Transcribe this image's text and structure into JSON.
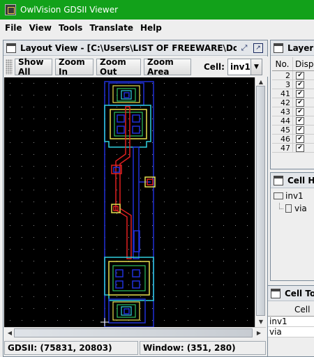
{
  "window": {
    "title": "OwlVision GDSII Viewer"
  },
  "menu": [
    "File",
    "View",
    "Tools",
    "Translate",
    "Help"
  ],
  "layout_view": {
    "title": "Layout View - [C:\\Users\\LIST OF FREEWARE\\Downloa...",
    "buttons": {
      "show_all": "Show All",
      "zoom_in": "Zoom In",
      "zoom_out": "Zoom Out",
      "zoom_area": "Zoom Area"
    },
    "cell_label": "Cell:",
    "cell_value": "inv1"
  },
  "status": {
    "gdsii": "GDSII: (75831, 20803)",
    "window": "Window: (351, 280)"
  },
  "layer_panel": {
    "title": "Layer",
    "columns": [
      "No.",
      "Disp"
    ],
    "rows": [
      "2",
      "3",
      "41",
      "42",
      "43",
      "44",
      "45",
      "46",
      "47"
    ]
  },
  "cell_hierarchy": {
    "title": "Cell Hie",
    "root": "inv1",
    "child": "via"
  },
  "cell_tool": {
    "title": "Cell To",
    "header": "Cell",
    "rows": [
      "inv1",
      "via"
    ]
  },
  "colors": {
    "titlebar": "#12a11a",
    "canvas": "#000000"
  }
}
